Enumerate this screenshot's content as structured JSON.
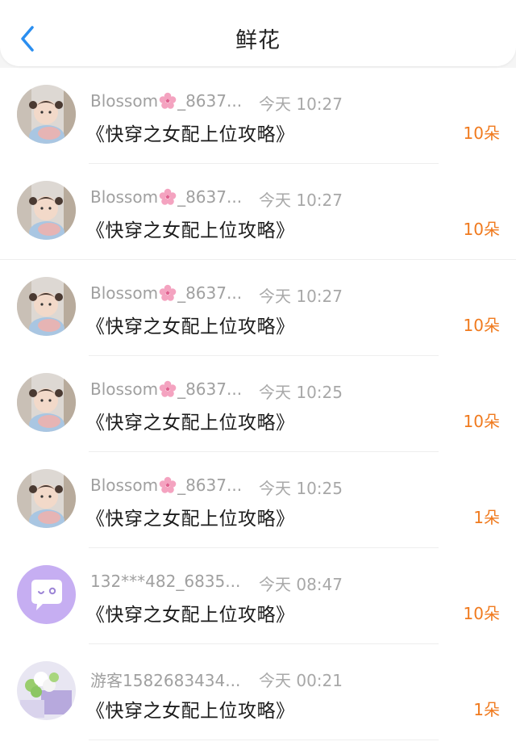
{
  "header": {
    "title": "鲜花",
    "back_icon": "chevron-left-icon",
    "back_color": "#2a8ef0"
  },
  "colors": {
    "accent_orange": "#f07a1e",
    "meta_gray": "#a0a0a0"
  },
  "records": [
    {
      "avatar": "child-photo",
      "user_prefix": "Blossom",
      "user_emoji": "cherry-blossom-icon",
      "user_suffix": "_8637...",
      "time": "今天 10:27",
      "book": "《快穿之女配上位攻略》",
      "count": "10朵"
    },
    {
      "avatar": "child-photo",
      "user_prefix": "Blossom",
      "user_emoji": "cherry-blossom-icon",
      "user_suffix": "_8637...",
      "time": "今天 10:27",
      "book": "《快穿之女配上位攻略》",
      "count": "10朵"
    },
    {
      "avatar": "child-photo",
      "user_prefix": "Blossom",
      "user_emoji": "cherry-blossom-icon",
      "user_suffix": "_8637...",
      "time": "今天 10:27",
      "book": "《快穿之女配上位攻略》",
      "count": "10朵"
    },
    {
      "avatar": "child-photo",
      "user_prefix": "Blossom",
      "user_emoji": "cherry-blossom-icon",
      "user_suffix": "_8637...",
      "time": "今天 10:25",
      "book": "《快穿之女配上位攻略》",
      "count": "10朵"
    },
    {
      "avatar": "child-photo",
      "user_prefix": "Blossom",
      "user_emoji": "cherry-blossom-icon",
      "user_suffix": "_8637...",
      "time": "今天 10:25",
      "book": "《快穿之女配上位攻略》",
      "count": "1朵"
    },
    {
      "avatar": "chat-bubble-icon",
      "user_prefix": "132***482_6835...",
      "user_emoji": "",
      "user_suffix": "",
      "time": "今天 08:47",
      "book": "《快穿之女配上位攻略》",
      "count": "10朵"
    },
    {
      "avatar": "flower-photo",
      "user_prefix": "游客1582683434...",
      "user_emoji": "",
      "user_suffix": "",
      "time": "今天 00:21",
      "book": "《快穿之女配上位攻略》",
      "count": "1朵"
    }
  ]
}
